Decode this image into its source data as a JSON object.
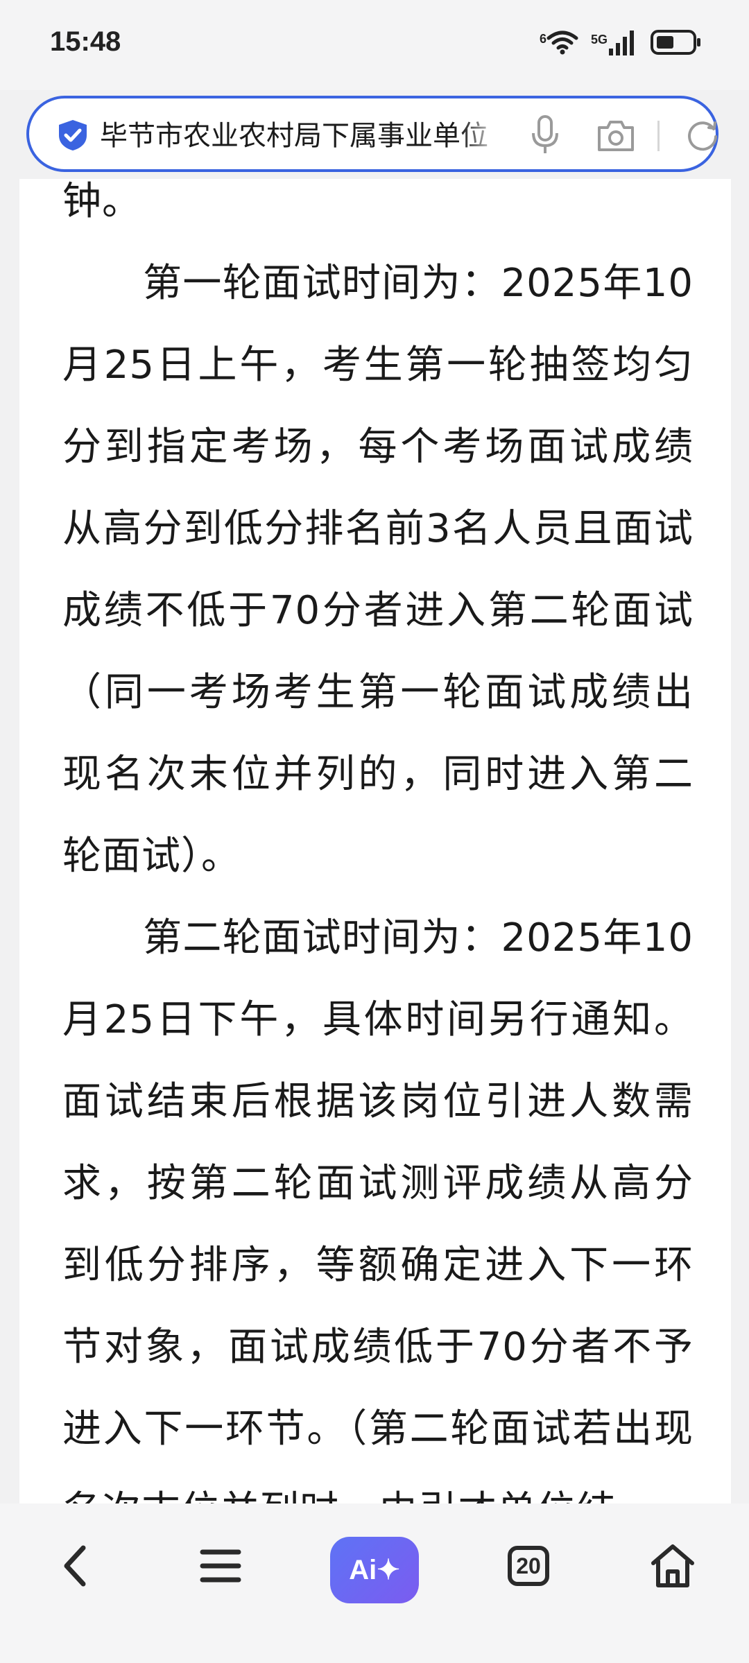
{
  "status_bar": {
    "time": "15:48",
    "wifi_label": "6",
    "network_label": "5G",
    "icons": [
      "wifi-icon",
      "signal-icon",
      "battery-icon"
    ]
  },
  "search_bar": {
    "query": "毕节市农业农村局下属事业单位",
    "icons": [
      "shield-icon",
      "mic-icon",
      "camera-icon",
      "refresh-icon"
    ],
    "border_color": "#3a63e0"
  },
  "article": {
    "paragraphs": [
      "钟。",
      "第一轮面试时间为：2025年10月25日上午，考生第一轮抽签均匀分到指定考场，每个考场面试成绩从高分到低分排名前3名人员且面试成绩不低于70分者进入第二轮面试（同一考场考生第一轮面试成绩出现名次末位并列的，同时进入第二轮面试）。",
      "第二轮面试时间为：2025年10月25日下午，具体时间另行通知。面试结束后根据该岗位引进人数需求，按第二轮面试测评成绩从高分到低分排序，等额确定进入下一环节对象，面试成绩低于70分者不予进入下一环节。（第二轮面试若出现名次末位并列时，由引才单位结"
    ]
  },
  "bottom_nav": {
    "ai_label": "Ai✦",
    "tab_count": "20",
    "icons": [
      "back-icon",
      "menu-icon",
      "tabs-icon",
      "home-icon"
    ],
    "accent": "#6a67f3"
  }
}
